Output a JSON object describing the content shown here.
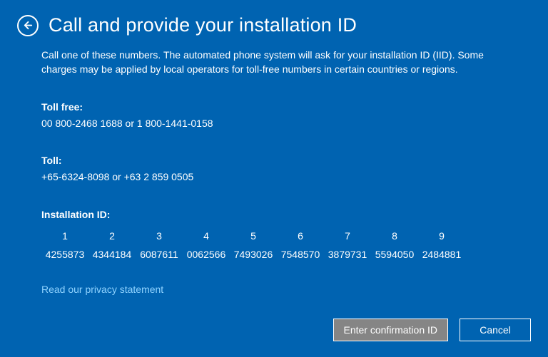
{
  "header": {
    "title": "Call and provide your installation ID"
  },
  "instructions": "Call one of these numbers. The automated phone system will ask for your installation ID (IID). Some charges may be applied by local operators for toll-free numbers in certain countries or regions.",
  "toll_free": {
    "label": "Toll free:",
    "value": "00 800-2468 1688 or 1 800-1441-0158"
  },
  "toll": {
    "label": "Toll:",
    "value": "+65-6324-8098 or +63 2 859 0505"
  },
  "installation_id": {
    "label": "Installation ID:",
    "columns": [
      "1",
      "2",
      "3",
      "4",
      "5",
      "6",
      "7",
      "8",
      "9"
    ],
    "values": [
      "4255873",
      "4344184",
      "6087611",
      "0062566",
      "7493026",
      "7548570",
      "3879731",
      "5594050",
      "2484881"
    ]
  },
  "privacy_link": "Read our privacy statement",
  "buttons": {
    "primary": "Enter confirmation ID",
    "cancel": "Cancel"
  }
}
